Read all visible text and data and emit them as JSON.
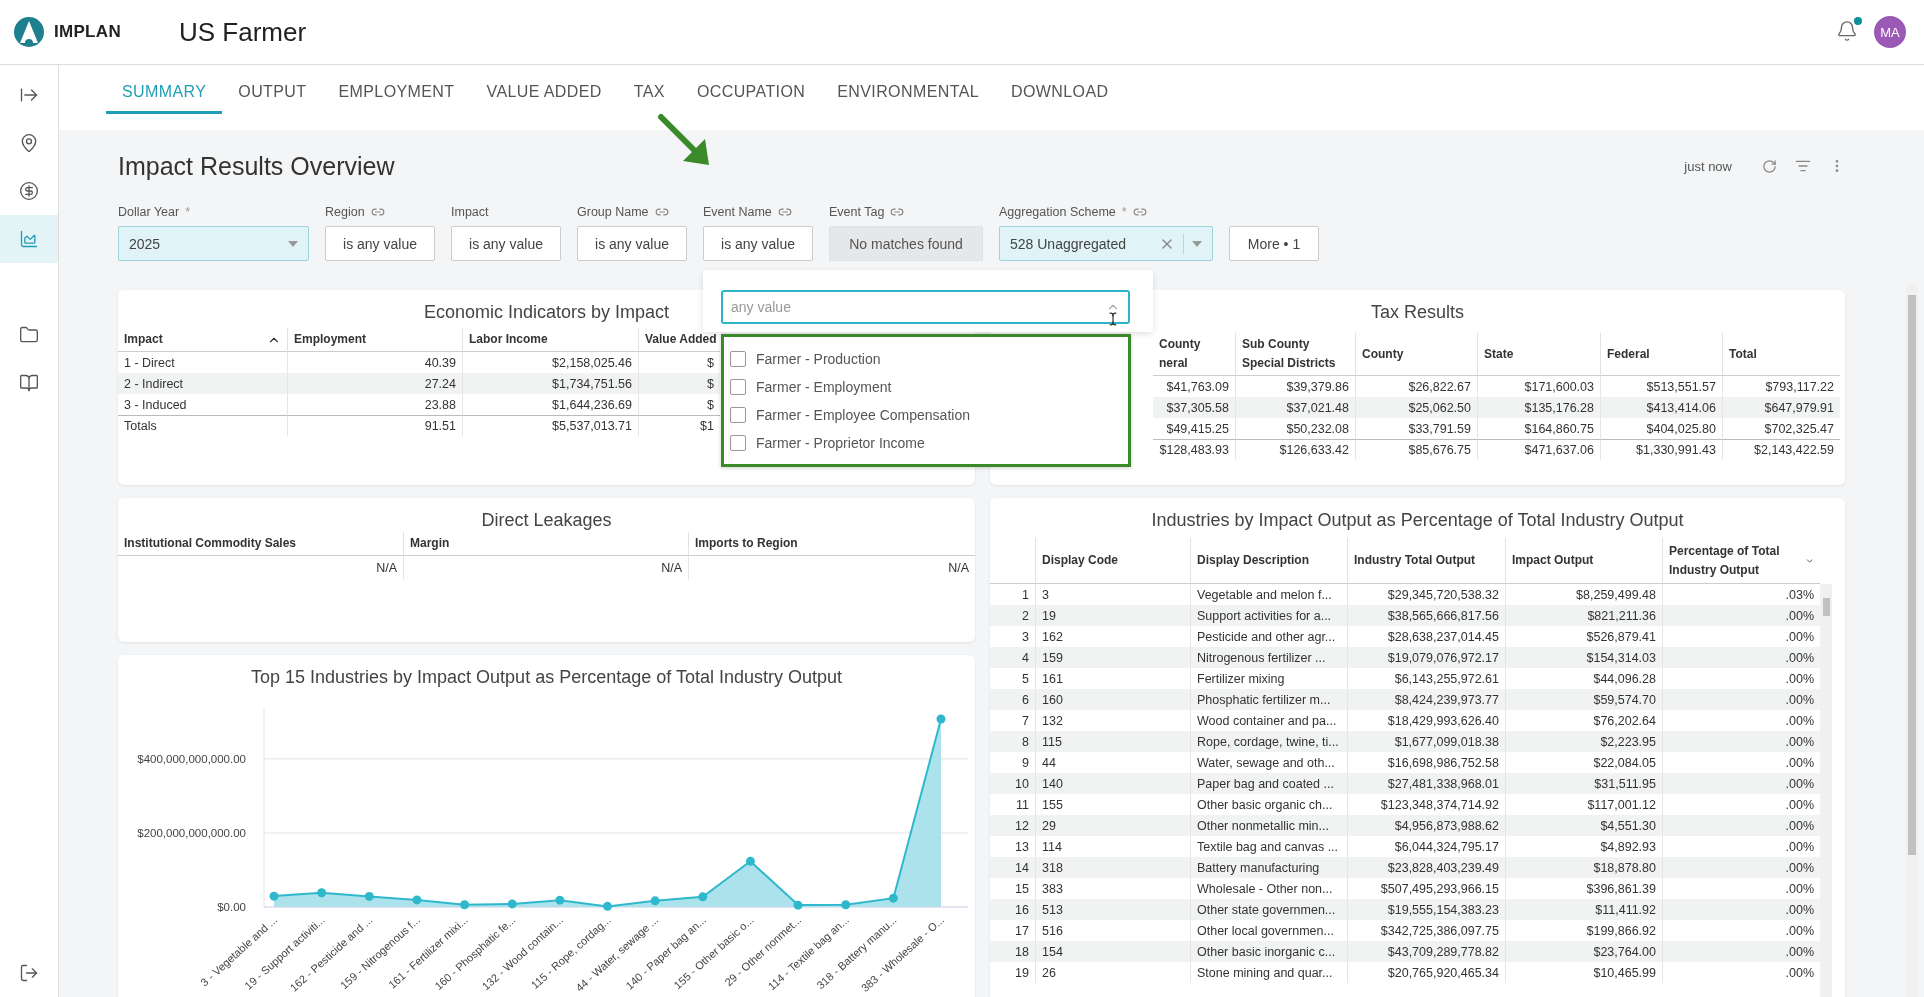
{
  "header": {
    "brand": "IMPLAN",
    "title": "US Farmer",
    "notification_unread": true,
    "avatar": "MA"
  },
  "sidebar": {
    "items": [
      {
        "kind": "expand",
        "selected": false
      },
      {
        "kind": "location",
        "selected": false
      },
      {
        "kind": "dollar",
        "selected": false
      },
      {
        "kind": "chart",
        "selected": true
      },
      {
        "kind": "folder",
        "selected": false
      },
      {
        "kind": "book",
        "selected": false
      }
    ],
    "footer": {
      "kind": "logout"
    }
  },
  "tabs": [
    {
      "label": "SUMMARY",
      "selected": true
    },
    {
      "label": "OUTPUT",
      "selected": false
    },
    {
      "label": "EMPLOYMENT",
      "selected": false
    },
    {
      "label": "VALUE ADDED",
      "selected": false
    },
    {
      "label": "TAX",
      "selected": false
    },
    {
      "label": "OCCUPATION",
      "selected": false
    },
    {
      "label": "ENVIRONMENTAL",
      "selected": false
    },
    {
      "label": "DOWNLOAD",
      "selected": false
    }
  ],
  "page": {
    "title": "Impact Results Overview",
    "updated": "just now"
  },
  "filters": [
    {
      "label": "Dollar Year",
      "required_mark": "*",
      "linked": false,
      "kind": "select",
      "value": "2025"
    },
    {
      "label": "Region",
      "linked": true,
      "kind": "text",
      "value": "is any value"
    },
    {
      "label": "Impact",
      "linked": false,
      "kind": "text",
      "value": "is any value"
    },
    {
      "label": "Group Name",
      "linked": true,
      "kind": "text",
      "value": "is any value"
    },
    {
      "label": "Event Name",
      "linked": true,
      "kind": "text",
      "value": "is any value"
    },
    {
      "label": "Event Tag",
      "linked": true,
      "kind": "disabled",
      "value": "No matches found"
    },
    {
      "label": "Aggregation Scheme",
      "required_mark": "*",
      "linked": true,
      "kind": "clearable",
      "value": "528 Unaggregated"
    }
  ],
  "more_button": "More • 1",
  "event_dropdown": {
    "placeholder": "any value",
    "options": [
      {
        "label": "Farmer - Production",
        "checked": false
      },
      {
        "label": "Farmer - Employment",
        "checked": false
      },
      {
        "label": "Farmer - Employee Compensation",
        "checked": false
      },
      {
        "label": "Farmer - Proprietor Income",
        "checked": false
      }
    ]
  },
  "economic_indicators": {
    "title": "Economic Indicators by Impact",
    "columns": [
      {
        "label": "Impact",
        "sort_ascending": true
      },
      {
        "label": "Employment"
      },
      {
        "label": "Labor Income"
      },
      {
        "label": "Value Added"
      }
    ],
    "rows": [
      {
        "kind": "data",
        "cells": [
          "1 - Direct",
          "40.39",
          "$2,158,025.46",
          "$"
        ]
      },
      {
        "kind": "data",
        "cells": [
          "2 - Indirect",
          "27.24",
          "$1,734,751.56",
          "$"
        ]
      },
      {
        "kind": "data",
        "cells": [
          "3 - Induced",
          "23.88",
          "$1,644,236.69",
          "$"
        ]
      },
      {
        "kind": "total",
        "cells": [
          "Totals",
          "91.51",
          "$5,537,013.71",
          "$1"
        ]
      }
    ]
  },
  "tax_results": {
    "title": "Tax Results",
    "columns": [
      {
        "label": "County neral"
      },
      {
        "label": "Sub County Special Districts"
      },
      {
        "label": "County"
      },
      {
        "label": "State"
      },
      {
        "label": "Federal"
      },
      {
        "label": "Total"
      }
    ],
    "rows": [
      {
        "kind": "data",
        "cells": [
          "$41,763.09",
          "$39,379.86",
          "$26,822.67",
          "$171,600.03",
          "$513,551.57",
          "$793,117.22"
        ]
      },
      {
        "kind": "data",
        "cells": [
          "$37,305.58",
          "$37,021.48",
          "$25,062.50",
          "$135,176.28",
          "$413,414.06",
          "$647,979.91"
        ]
      },
      {
        "kind": "data",
        "cells": [
          "$49,415.25",
          "$50,232.08",
          "$33,791.59",
          "$164,860.75",
          "$404,025.80",
          "$702,325.47"
        ]
      },
      {
        "kind": "total",
        "cells": [
          "$128,483.93",
          "$126,633.42",
          "$85,676.75",
          "$471,637.06",
          "$1,330,991.43",
          "$2,143,422.59"
        ]
      }
    ]
  },
  "direct_leakages": {
    "title": "Direct Leakages",
    "columns": [
      {
        "label": "Institutional Commodity Sales"
      },
      {
        "label": "Margin"
      },
      {
        "label": "Imports to Region"
      }
    ],
    "rows": [
      {
        "cells": [
          "N/A",
          "N/A",
          "N/A"
        ]
      }
    ]
  },
  "top_industries_chart": {
    "title": "Top 15 Industries by Impact Output as Percentage of Total Industry Output",
    "chart_data": {
      "type": "area",
      "categories": [
        "3 - Vegetable and ...",
        "19 - Support activiti...",
        "162 - Pesticide and ...",
        "159 - Nitrogenous f...",
        "161 - Fertilizer mixi...",
        "160 - Phosphatic fe...",
        "132 - Wood contain...",
        "115 - Rope, cordag...",
        "44 - Water, sewage ...",
        "140 - Paper bag an...",
        "155 - Other basic o...",
        "29 - Other nonmet...",
        "114 - Textile bag an...",
        "318 - Battery manu...",
        "383 - Wholesale - O..."
      ],
      "series": [
        {
          "color": "#2fb8cc",
          "values": [
            29300000000,
            38600000000,
            28600000000,
            19100000000,
            6100000000,
            8400000000,
            18400000000,
            1700000000,
            16700000000,
            27500000000,
            123300000000,
            5000000000,
            6000000000,
            23800000000,
            507500000000
          ]
        }
      ],
      "ylim": [
        0,
        540000000000
      ],
      "yticks": [
        {
          "value": 0,
          "label": "$0.00"
        },
        {
          "value": 200000000000,
          "label": "$200,000,000,000.00"
        },
        {
          "value": 400000000000,
          "label": "$400,000,000,000.00"
        }
      ]
    }
  },
  "industries_table": {
    "title": "Industries by Impact Output as Percentage of Total Industry Output",
    "columns": [
      {
        "label": "Display Code"
      },
      {
        "label": "Display Description"
      },
      {
        "label": "Industry Total Output"
      },
      {
        "label": "Impact Output"
      },
      {
        "label": "Percentage of Total Industry Output",
        "sort_ascending": false
      }
    ],
    "rows": [
      {
        "number": "1",
        "cells": [
          "3",
          "Vegetable and melon f...",
          "$29,345,720,538.32",
          "$8,259,499.48",
          ".03%"
        ]
      },
      {
        "number": "2",
        "cells": [
          "19",
          "Support activities for a...",
          "$38,565,666,817.56",
          "$821,211.36",
          ".00%"
        ]
      },
      {
        "number": "3",
        "cells": [
          "162",
          "Pesticide and other agr...",
          "$28,638,237,014.45",
          "$526,879.41",
          ".00%"
        ]
      },
      {
        "number": "4",
        "cells": [
          "159",
          "Nitrogenous fertilizer ...",
          "$19,079,076,972.17",
          "$154,314.03",
          ".00%"
        ]
      },
      {
        "number": "5",
        "cells": [
          "161",
          "Fertilizer mixing",
          "$6,143,255,972.61",
          "$44,096.28",
          ".00%"
        ]
      },
      {
        "number": "6",
        "cells": [
          "160",
          "Phosphatic fertilizer m...",
          "$8,424,239,973.77",
          "$59,574.70",
          ".00%"
        ]
      },
      {
        "number": "7",
        "cells": [
          "132",
          "Wood container and pa...",
          "$18,429,993,626.40",
          "$76,202.64",
          ".00%"
        ]
      },
      {
        "number": "8",
        "cells": [
          "115",
          "Rope, cordage, twine, ti...",
          "$1,677,099,018.38",
          "$2,223.95",
          ".00%"
        ]
      },
      {
        "number": "9",
        "cells": [
          "44",
          "Water, sewage and oth...",
          "$16,698,986,752.58",
          "$22,084.05",
          ".00%"
        ]
      },
      {
        "number": "10",
        "cells": [
          "140",
          "Paper bag and coated ...",
          "$27,481,338,968.01",
          "$31,511.95",
          ".00%"
        ]
      },
      {
        "number": "11",
        "cells": [
          "155",
          "Other basic organic ch...",
          "$123,348,374,714.92",
          "$117,001.12",
          ".00%"
        ]
      },
      {
        "number": "12",
        "cells": [
          "29",
          "Other nonmetallic min...",
          "$4,956,873,988.62",
          "$4,551.30",
          ".00%"
        ]
      },
      {
        "number": "13",
        "cells": [
          "114",
          "Textile bag and canvas ...",
          "$6,044,324,795.17",
          "$4,892.93",
          ".00%"
        ]
      },
      {
        "number": "14",
        "cells": [
          "318",
          "Battery manufacturing",
          "$23,828,403,239.49",
          "$18,878.80",
          ".00%"
        ]
      },
      {
        "number": "15",
        "cells": [
          "383",
          "Wholesale - Other non...",
          "$507,495,293,966.15",
          "$396,861.39",
          ".00%"
        ]
      },
      {
        "number": "16",
        "cells": [
          "513",
          "Other state governmen...",
          "$19,555,154,383.23",
          "$11,411.92",
          ".00%"
        ]
      },
      {
        "number": "17",
        "cells": [
          "516",
          "Other local governmen...",
          "$342,725,386,097.75",
          "$199,866.92",
          ".00%"
        ]
      },
      {
        "number": "18",
        "cells": [
          "154",
          "Other basic inorganic c...",
          "$43,709,289,778.82",
          "$23,764.00",
          ".00%"
        ]
      },
      {
        "number": "19",
        "cells": [
          "26",
          "Stone mining and quar...",
          "$20,765,920,465.34",
          "$10,465.99",
          ".00%"
        ]
      }
    ]
  }
}
